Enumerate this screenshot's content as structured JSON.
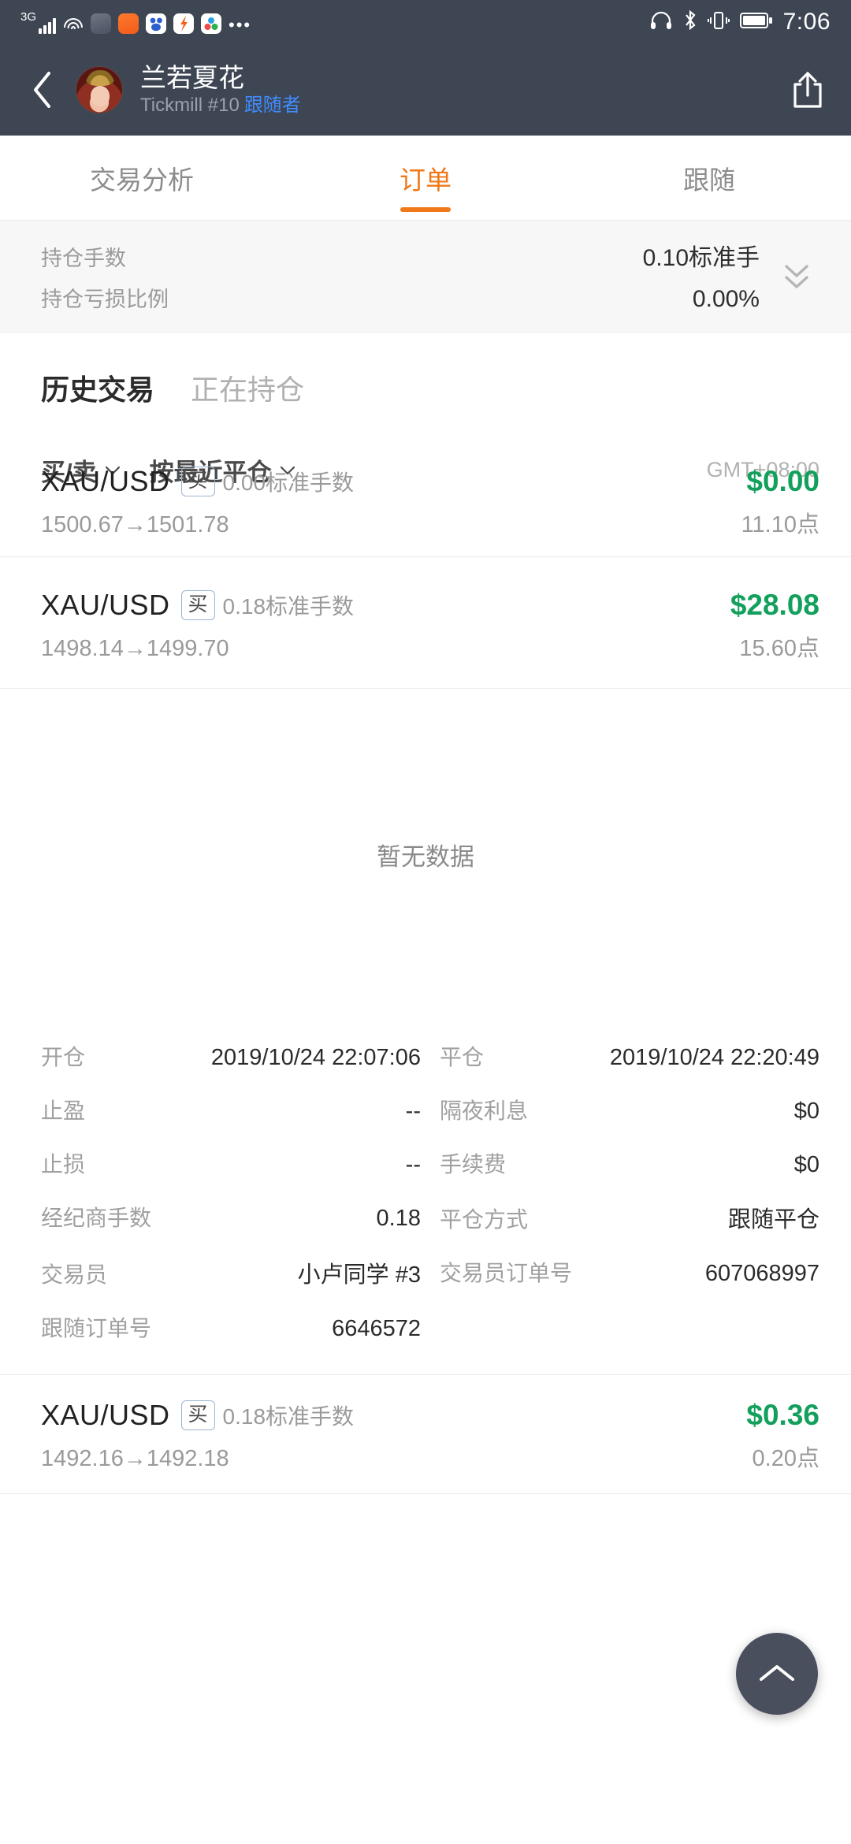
{
  "statusbar": {
    "network_label": "3G",
    "time": "7:06",
    "icons": [
      "signal-bars-icon",
      "wifi-icon",
      "uc-browser-icon",
      "alipay-icon",
      "baidu-icon",
      "app-f-icon",
      "app-green-icon",
      "overflow-dots-icon",
      "headphones-icon",
      "bluetooth-icon",
      "vibrate-icon",
      "battery-icon"
    ]
  },
  "header": {
    "back_icon": "chevron-left-icon",
    "name": "兰若夏花",
    "broker": "Tickmill #10",
    "role": "跟随者",
    "share_icon": "share-icon"
  },
  "tabs": [
    {
      "label": "交易分析",
      "active": false
    },
    {
      "label": "订单",
      "active": true
    },
    {
      "label": "跟随",
      "active": false
    }
  ],
  "summary": {
    "rows": [
      {
        "label": "持仓手数",
        "value": "0.10标准手"
      },
      {
        "label": "持仓亏损比例",
        "value": "0.00%"
      }
    ],
    "expand_icon": "double-chevron-down-icon"
  },
  "subtabs": [
    {
      "label": "历史交易",
      "active": true
    },
    {
      "label": "正在持仓",
      "active": false
    }
  ],
  "filters": {
    "side": "买/卖",
    "sort": "按最近平仓",
    "timezone": "GMT+08:00"
  },
  "trades": [
    {
      "symbol": "XAU/USD",
      "side": "买",
      "lots": "0.00标准手数",
      "pnl": "$0.00",
      "open_price": "1500.67",
      "close_price": "1501.78",
      "prices": "1500.67→1501.78",
      "pips": "11.10点"
    },
    {
      "symbol": "XAU/USD",
      "side": "买",
      "lots": "0.18标准手数",
      "pnl": "$28.08",
      "open_price": "1498.14",
      "close_price": "1499.70",
      "prices": "1498.14→1499.70",
      "pips": "15.60点"
    },
    {
      "symbol": "XAU/USD",
      "side": "买",
      "lots": "0.18标准手数",
      "pnl": "$0.36",
      "open_price": "1492.16",
      "close_price": "1492.18",
      "prices": "1492.16→1492.18",
      "pips": "0.20点"
    }
  ],
  "empty_state": {
    "text": "暂无数据"
  },
  "detail": {
    "rows": [
      {
        "left_label": "开仓",
        "left_value": "2019/10/24 22:07:06",
        "right_label": "平仓",
        "right_value": "2019/10/24 22:20:49"
      },
      {
        "left_label": "止盈",
        "left_value": "--",
        "right_label": "隔夜利息",
        "right_value": "$0"
      },
      {
        "left_label": "止损",
        "left_value": "--",
        "right_label": "手续费",
        "right_value": "$0"
      },
      {
        "left_label": "经纪商手数",
        "left_value": "0.18",
        "right_label": "平仓方式",
        "right_value": "跟随平仓"
      },
      {
        "left_label": "交易员",
        "left_value": "小卢同学 #3",
        "right_label": "交易员订单号",
        "right_value": "607068997"
      },
      {
        "left_label": "跟随订单号",
        "left_value": "6646572",
        "right_label": "",
        "right_value": ""
      }
    ]
  },
  "fab": {
    "icon": "chevron-up-icon"
  },
  "colors": {
    "header_bg": "#3e4654",
    "accent": "#f07818",
    "profit_green": "#12a05c",
    "link_blue": "#3f8dfd"
  }
}
